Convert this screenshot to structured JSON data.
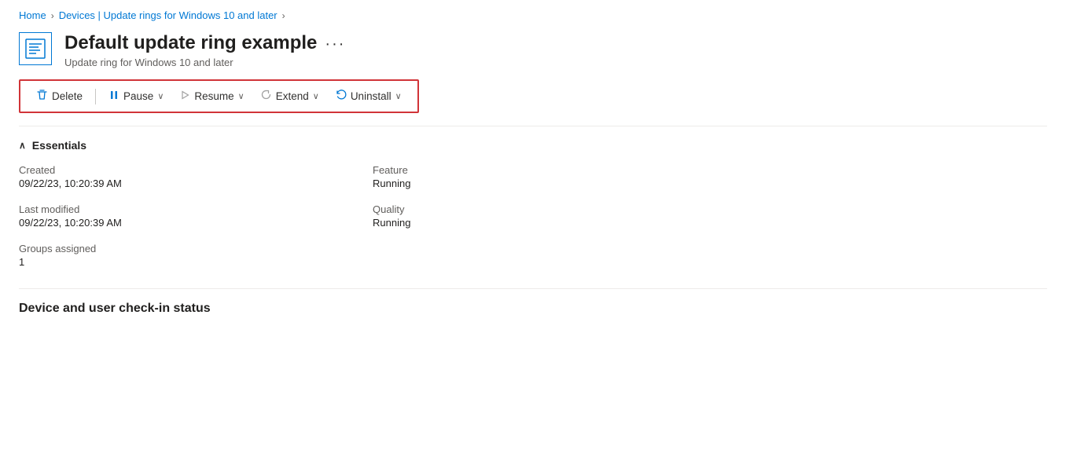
{
  "breadcrumb": {
    "items": [
      {
        "label": "Home",
        "id": "home"
      },
      {
        "label": "Devices | Update rings for Windows 10 and later",
        "id": "devices-update-rings"
      }
    ],
    "separator": "›"
  },
  "page": {
    "title": "Default update ring example",
    "subtitle": "Update ring for Windows 10 and later",
    "more_options_label": "···"
  },
  "toolbar": {
    "buttons": [
      {
        "id": "delete",
        "label": "Delete",
        "icon": "trash",
        "has_dropdown": false
      },
      {
        "id": "pause",
        "label": "Pause",
        "icon": "pause",
        "has_dropdown": true
      },
      {
        "id": "resume",
        "label": "Resume",
        "icon": "play",
        "has_dropdown": true
      },
      {
        "id": "extend",
        "label": "Extend",
        "icon": "refresh",
        "has_dropdown": true
      },
      {
        "id": "uninstall",
        "label": "Uninstall",
        "icon": "undo",
        "has_dropdown": true
      }
    ]
  },
  "essentials": {
    "header": "Essentials",
    "left_items": [
      {
        "label": "Created",
        "value": "09/22/23, 10:20:39 AM"
      },
      {
        "label": "Last modified",
        "value": "09/22/23, 10:20:39 AM"
      },
      {
        "label": "Groups assigned",
        "value": "1"
      }
    ],
    "right_items": [
      {
        "label": "Feature",
        "value": "Running"
      },
      {
        "label": "Quality",
        "value": "Running"
      }
    ]
  },
  "bottom_section": {
    "title": "Device and user check-in status"
  }
}
